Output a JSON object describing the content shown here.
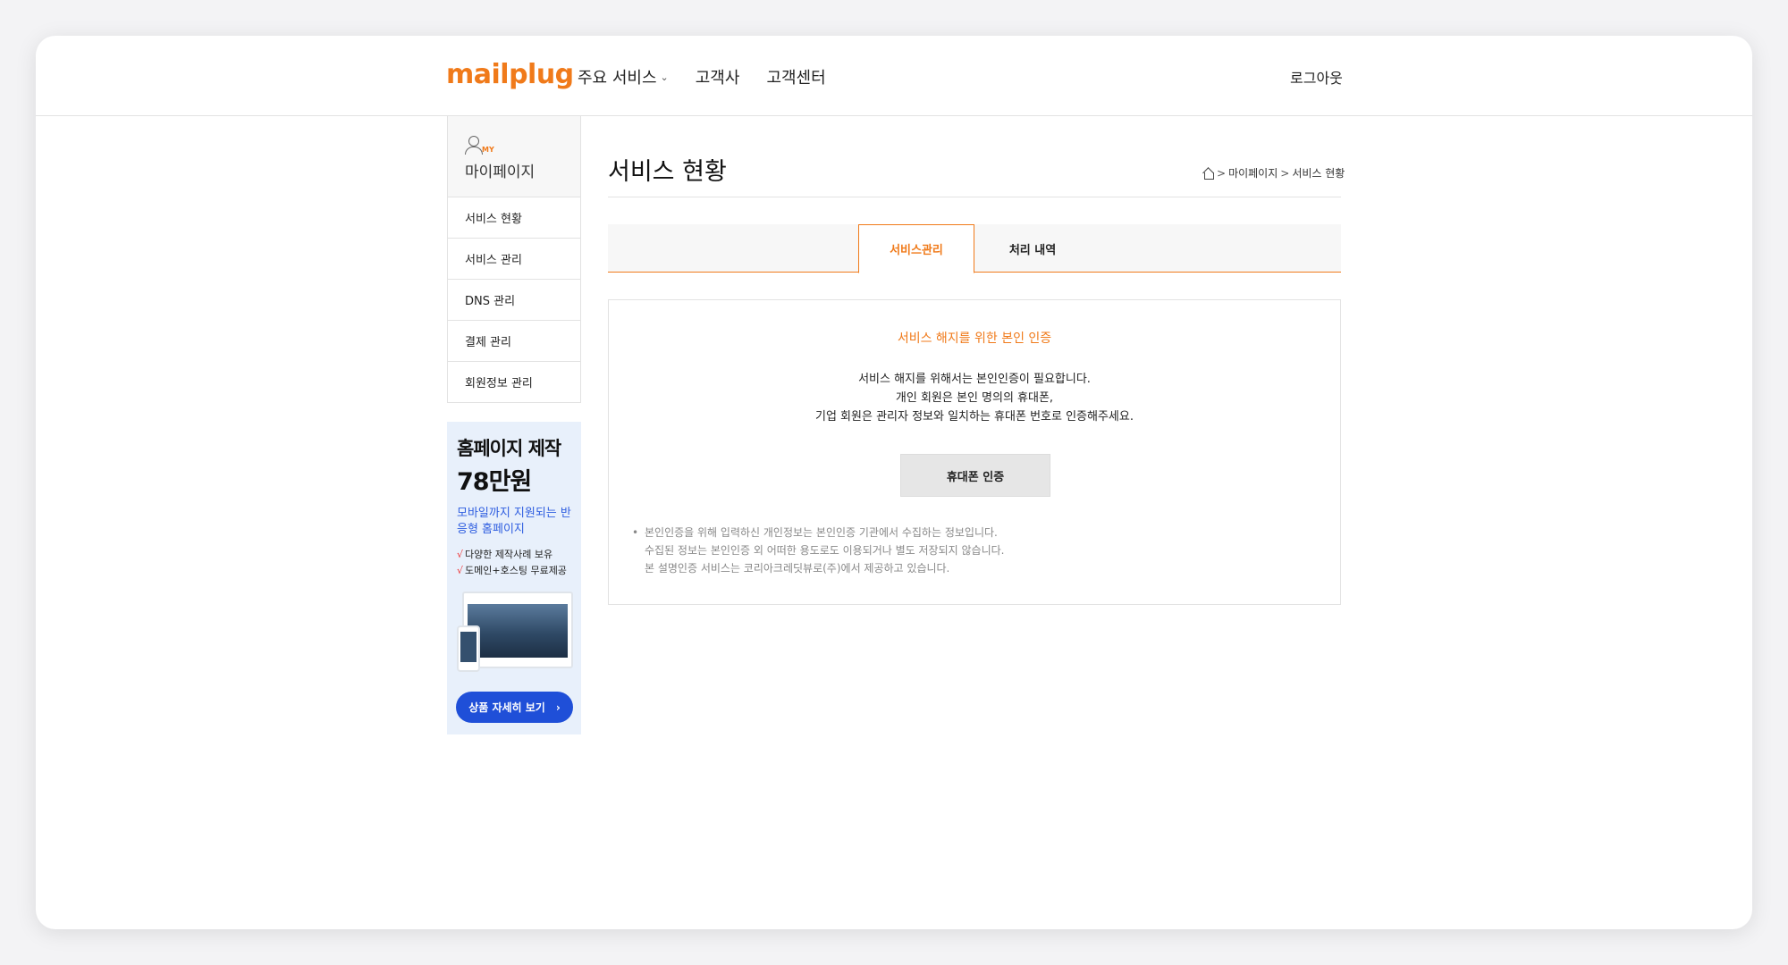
{
  "header": {
    "logo": "mailplug",
    "nav": [
      {
        "label": "주요 서비스",
        "chevron": "⌄"
      },
      {
        "label": "고객사"
      },
      {
        "label": "고객센터"
      }
    ],
    "logout": "로그아웃"
  },
  "sidebar": {
    "badge": "MY",
    "title": "마이페이지",
    "items": [
      {
        "label": "서비스 현황"
      },
      {
        "label": "서비스 관리"
      },
      {
        "label": "DNS 관리"
      },
      {
        "label": "결제 관리"
      },
      {
        "label": "회원정보 관리"
      }
    ]
  },
  "ad": {
    "line1": "홈페이지 제작",
    "line2": "78만원",
    "subtitle": "모바일까지 지원되는 반응형 홈페이지",
    "checks": [
      "다양한 제작사례 보유",
      "도메인+호스팅 무료제공"
    ],
    "button": "상품 자세히 보기",
    "button_arrow": "›"
  },
  "main": {
    "title": "서비스 현황",
    "breadcrumb": [
      "마이페이지",
      "서비스 현황"
    ],
    "breadcrumb_sep": ">",
    "tabs": [
      {
        "label": "서비스관리",
        "active": true
      },
      {
        "label": "처리 내역",
        "active": false
      }
    ],
    "card": {
      "title": "서비스 해지를 위한 본인 인증",
      "desc": [
        "서비스 해지를 위해서는 본인인증이 필요합니다.",
        "개인 회원은 본인 명의의 휴대폰,",
        "기업 회원은 관리자 정보와 일치하는 휴대폰 번호로 인증해주세요."
      ],
      "button": "휴대폰 인증",
      "notes": [
        "본인인증을 위해 입력하신 개인정보는 본인인증 기관에서 수집하는 정보입니다.",
        "수집된 정보는 본인인증 외 어떠한 용도로도 이용되거나 별도 저장되지 않습니다.",
        "본 설명인증 서비스는 코리아크레딧뷰로(주)에서 제공하고 있습니다."
      ],
      "bullet": "•"
    }
  },
  "colors": {
    "accent": "#f07a1a",
    "ad_button": "#1f4fd8",
    "ad_bg": "#e8f0fb"
  }
}
